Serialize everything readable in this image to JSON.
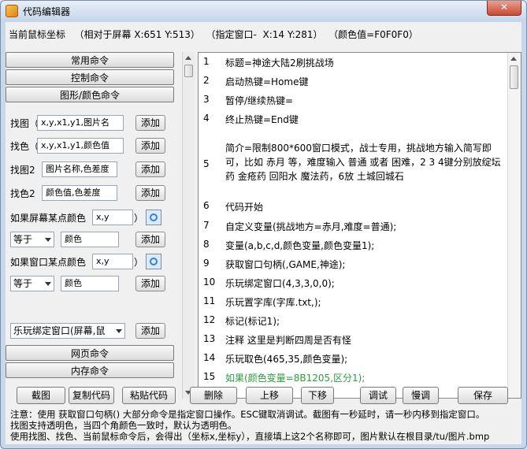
{
  "window": {
    "title": "代码编辑器",
    "close_label": "✕"
  },
  "status": {
    "text": "当前鼠标坐标   （相对于屏幕 X:651 Y:513）  （指定窗口-  X:14 Y:281）  （颜色值=F0F0F0）"
  },
  "categories": {
    "common": "常用命令",
    "control": "控制命令",
    "graphic": "图形/颜色命令",
    "web": "网页命令",
    "memory": "内存命令"
  },
  "find_image": {
    "label": "找图（",
    "value": "x,y,x1,y1,图片名",
    "add": "添加"
  },
  "find_color": {
    "label": "找色（",
    "value": "x,y,x1,y1,颜色值",
    "add": "添加"
  },
  "find_image2": {
    "label": "找图2（",
    "value": "图片名称,色差度",
    "add": "添加"
  },
  "find_color2": {
    "label": "找色2（",
    "value": "颜色值,色差度",
    "add": "添加"
  },
  "screen_color": {
    "label": "如果屏幕某点颜色（",
    "value": "x,y",
    "close": "）",
    "op": "等于",
    "color_value": "颜色",
    "add": "添加"
  },
  "window_color": {
    "label": "如果窗口某点颜色（",
    "value": "x,y",
    "close": "）",
    "op": "等于",
    "color_value": "颜色",
    "add": "添加"
  },
  "bind_window": {
    "value": "乐玩绑定窗口(屏幕,鼠",
    "add": "添加"
  },
  "code_lines": [
    {
      "n": "1",
      "t": "标题=神途大陆2刷挑战场"
    },
    {
      "n": "2",
      "t": "启动热键=Home键"
    },
    {
      "n": "3",
      "t": "暂停/继续热键="
    },
    {
      "n": "4",
      "t": "终止热键=End键"
    },
    {
      "n": "5",
      "t": "简介=限制800*600窗口模式，战士专用，挑战地方输入简写即可，比如 赤月 等，难度输入 普通 或者 困难，2 3 4键分别放绽坛药 金疮药 回阳水 魔法药，6放 土城回城石"
    },
    {
      "n": "6",
      "t": "代码开始"
    },
    {
      "n": "7",
      "t": "自定义变量(挑战地方=赤月,难度=普通);"
    },
    {
      "n": "8",
      "t": "变量(a,b,c,d,颜色变量,颜色变量1);"
    },
    {
      "n": "9",
      "t": "获取窗口句柄(,GAME,神途);"
    },
    {
      "n": "10",
      "t": "乐玩绑定窗口(4,3,3,0,0);"
    },
    {
      "n": "11",
      "t": "乐玩置字库(字库.txt,);"
    },
    {
      "n": "12",
      "t": "标记(标记1);"
    },
    {
      "n": "13",
      "t": "注释 这里是判断四周是否有怪"
    },
    {
      "n": "14",
      "t": "乐玩取色(465,35,颜色变量);"
    },
    {
      "n": "15",
      "t": "如果(颜色变量=8B1205,区分1);"
    }
  ],
  "buttons": {
    "screenshot": "截图",
    "copy": "复制代码",
    "paste": "粘贴代码",
    "delete": "删除",
    "up": "上移",
    "down": "下移",
    "debug": "调试",
    "slow": "慢调",
    "save": "保存"
  },
  "notes": [
    "注意：使用 获取窗口句柄() 大部分命令是指定窗口操作。ESC键取消调试。截图有一秒延时，请一秒内移到指定窗口。",
    "找图支持透明色，当四个角颜色一致时，默认为透明色。",
    "使用找图、找色、当前鼠标命令后，会得出（坐标x,坐标y），直接填上这2个名称即可，图片默认在根目录/tu/图片.bmp"
  ]
}
